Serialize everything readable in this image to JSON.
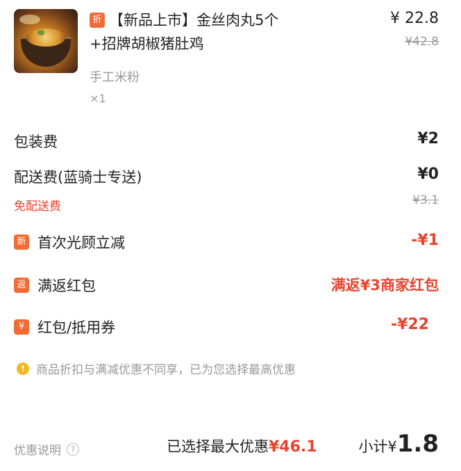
{
  "item": {
    "discount_tag": "折",
    "title_line1": "【新品上市】金丝肉丸5个",
    "title_line2": "+招牌胡椒猪肚鸡",
    "spec": "手工米粉",
    "quantity": "×1",
    "price": "¥ 22.8",
    "original_price": "¥42.8"
  },
  "fees": {
    "packaging_label": "包装费",
    "packaging_value": "¥2",
    "delivery_label": "配送费(蓝骑士专送)",
    "delivery_value": "¥0",
    "delivery_original": "¥3.1",
    "free_delivery_note": "免配送费"
  },
  "promotions": [
    {
      "icon": "新",
      "label": "首次光顾立减",
      "value": "-¥1"
    },
    {
      "icon": "返",
      "label": "满返红包",
      "value": "满返¥3商家红包"
    },
    {
      "icon": "¥",
      "label": "红包/抵用券",
      "value": "-¥22"
    }
  ],
  "notice": {
    "icon": "!",
    "text": "商品折扣与满减优惠不同享，已为您选择最高优惠"
  },
  "footer": {
    "explain_label": "优惠说明",
    "help_icon": "?",
    "max_discount_label": "已选择最大优惠",
    "max_discount_value": "¥46.1",
    "subtotal_label": "小计¥",
    "subtotal_value": "1.8"
  },
  "colors": {
    "accent": "#e8432e",
    "tag": "#f06a3a",
    "muted": "#999999"
  }
}
